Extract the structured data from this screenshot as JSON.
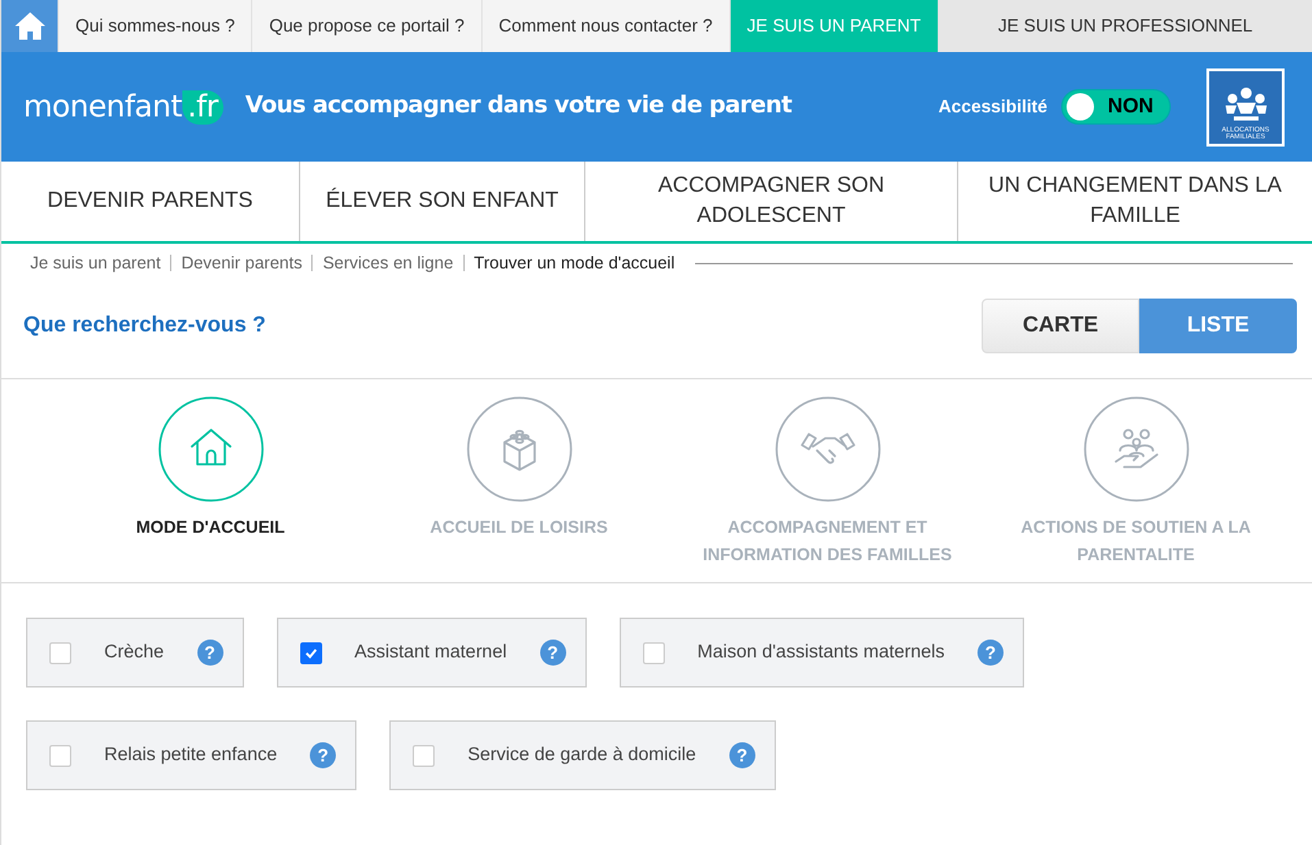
{
  "top_bar": {
    "links": [
      {
        "label": "Qui sommes-nous ?",
        "kind": "link",
        "selected": false
      },
      {
        "label": "Que propose ce portail ?",
        "kind": "link",
        "selected": false
      },
      {
        "label": "Comment nous contacter ?",
        "kind": "link",
        "selected": false
      },
      {
        "label": "JE SUIS UN PARENT",
        "kind": "audience",
        "selected": true
      },
      {
        "label": "JE SUIS UN PROFESSIONNEL",
        "kind": "audience",
        "selected": false
      }
    ]
  },
  "header": {
    "logo": {
      "name": "monenfant",
      "suffix": ".fr"
    },
    "tagline": "Vous accompagner dans votre vie de parent",
    "accessibility": {
      "label": "Accessibilité",
      "on": false,
      "state_text": "NON"
    },
    "partner_logo": {
      "text": "ALLOCATIONS FAMILIALES"
    }
  },
  "main_nav": [
    {
      "label": "DEVENIR PARENTS"
    },
    {
      "label": "ÉLEVER SON ENFANT"
    },
    {
      "label": "ACCOMPAGNER SON ADOLESCENT"
    },
    {
      "label": "UN CHANGEMENT DANS LA FAMILLE"
    }
  ],
  "breadcrumb": [
    {
      "label": "Je suis un parent",
      "current": false
    },
    {
      "label": "Devenir parents",
      "current": false
    },
    {
      "label": "Services en ligne",
      "current": false
    },
    {
      "label": "Trouver un mode d'accueil",
      "current": true
    }
  ],
  "search": {
    "title": "Que recherchez-vous ?",
    "views": [
      {
        "label": "CARTE",
        "selected": false
      },
      {
        "label": "LISTE",
        "selected": true
      }
    ]
  },
  "categories": [
    {
      "label": "MODE D'ACCUEIL",
      "kind": "house",
      "selected": true
    },
    {
      "label": "ACCUEIL DE LOISIRS",
      "kind": "blocks",
      "selected": false
    },
    {
      "label": "ACCOMPAGNEMENT ET INFORMATION DES FAMILLES",
      "kind": "handshake",
      "selected": false
    },
    {
      "label": "ACTIONS DE SOUTIEN A LA PARENTALITE",
      "kind": "family",
      "selected": false
    }
  ],
  "filters": [
    {
      "label": "Crèche",
      "checked": false,
      "help": "?"
    },
    {
      "label": "Assistant maternel",
      "checked": true,
      "help": "?"
    },
    {
      "label": "Maison d'assistants maternels",
      "checked": false,
      "help": "?"
    },
    {
      "label": "Relais petite enfance",
      "checked": false,
      "help": "?"
    },
    {
      "label": "Service de garde à domicile",
      "checked": false,
      "help": "?"
    }
  ]
}
